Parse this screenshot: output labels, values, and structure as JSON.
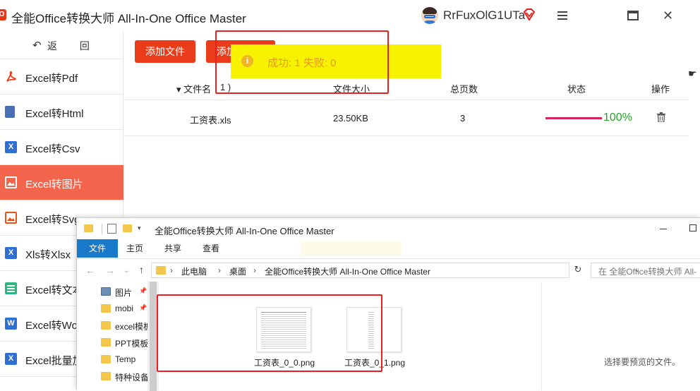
{
  "app": {
    "logo_letter": "O",
    "title": "全能Office转换大师 All-In-One Office Master",
    "username": "RrFuxOlG1UTa"
  },
  "sidebar": {
    "back_label": "返 回",
    "items": [
      {
        "label": "Excel转Pdf",
        "icon": "pdf-icon",
        "color": "#e8381b"
      },
      {
        "label": "Excel转Html",
        "icon": "html-icon",
        "color": "#4b6fb5"
      },
      {
        "label": "Excel转Csv",
        "icon": "csv-icon",
        "color": "#2e6fd1"
      },
      {
        "label": "Excel转图片",
        "icon": "image-icon",
        "color": "#ffffff",
        "active": true
      },
      {
        "label": "Excel转Svg",
        "icon": "svg-icon",
        "color": "#e8531b"
      },
      {
        "label": "Xls转Xlsx",
        "icon": "xlsx-icon",
        "color": "#2e6fd1"
      },
      {
        "label": "Excel转文本",
        "icon": "text-icon",
        "color": "#2bb57f"
      },
      {
        "label": "Excel转Wo",
        "icon": "word-icon",
        "color": "#2e6fd1"
      },
      {
        "label": "Excel批量加",
        "icon": "batch-icon",
        "color": "#2e6fd1"
      }
    ]
  },
  "toolbar": {
    "add_file_label": "添加文件",
    "add_folder_label": "添加"
  },
  "table": {
    "headers": {
      "file_name": "▾ 文件名",
      "file_name_count": "1 )",
      "file_size": "文件大小",
      "total_pages": "总页数",
      "status": "状态",
      "action": "操作"
    },
    "rows": [
      {
        "file_name": "工资表.xls",
        "file_size": "23.50KB",
        "pages": "3",
        "progress": 100,
        "progress_text": "100%"
      }
    ]
  },
  "toast": {
    "icon_char": "i",
    "text": "成功: 1  失败: 0"
  },
  "explorer": {
    "title": "全能Office转换大师 All-In-One Office Master",
    "tabs": [
      "文件",
      "主页",
      "共享",
      "查看"
    ],
    "breadcrumb": [
      "此电脑",
      "桌面",
      "全能Office转换大师 All-In-One Office Master"
    ],
    "search_placeholder": "在 全能Office转换大师 All-",
    "nav_items": [
      {
        "label": "图片",
        "icon": "pictures-folder-icon",
        "pinned": true
      },
      {
        "label": "mobi",
        "icon": "folder-icon",
        "pinned": true
      },
      {
        "label": "excel模板",
        "icon": "folder-icon"
      },
      {
        "label": "PPT模板",
        "icon": "folder-icon"
      },
      {
        "label": "Temp",
        "icon": "folder-icon"
      },
      {
        "label": "特种设备",
        "icon": "folder-icon"
      }
    ],
    "files": [
      {
        "name": "工资表_0_0.png"
      },
      {
        "name": "工资表_0_1.png"
      }
    ],
    "preview_text": "选择要预览的文件。"
  },
  "colors": {
    "accent": "#ea3c1a",
    "active_sidebar": "#f4654e",
    "toast_bg": "#f7f300",
    "progress": "#d8245a",
    "success_text": "#26a326",
    "explorer_file_tab": "#1979ca",
    "highlight_box": "#e8211d"
  }
}
